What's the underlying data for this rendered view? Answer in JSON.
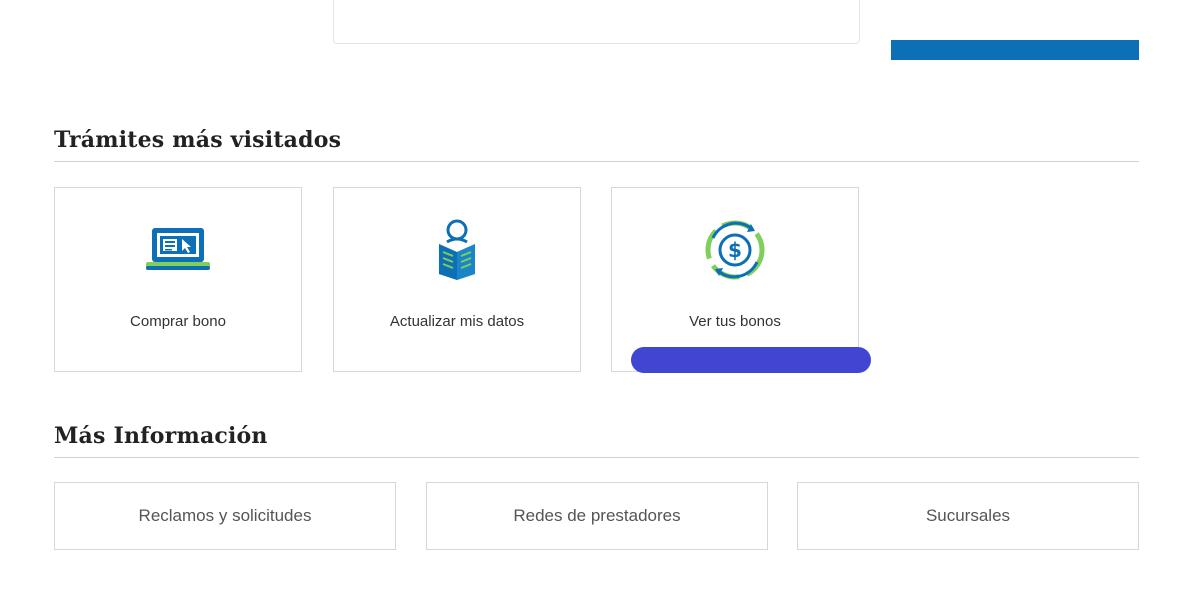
{
  "colors": {
    "brand_blue": "#0d6fb5",
    "accent_green": "#7fcf5a",
    "focus_indicator": "#4146d2",
    "card_border": "#d6d7de"
  },
  "tramites": {
    "title": "Trámites más visitados",
    "cards": [
      {
        "label": "Comprar bono",
        "icon": "laptop-icon"
      },
      {
        "label": "Actualizar mis datos",
        "icon": "person-reading-icon"
      },
      {
        "label": "Ver tus bonos",
        "icon": "dollar-refresh-icon"
      }
    ]
  },
  "mas_info": {
    "title": "Más Información",
    "links": [
      {
        "label": "Reclamos y solicitudes"
      },
      {
        "label": "Redes de prestadores"
      },
      {
        "label": "Sucursales"
      }
    ]
  }
}
